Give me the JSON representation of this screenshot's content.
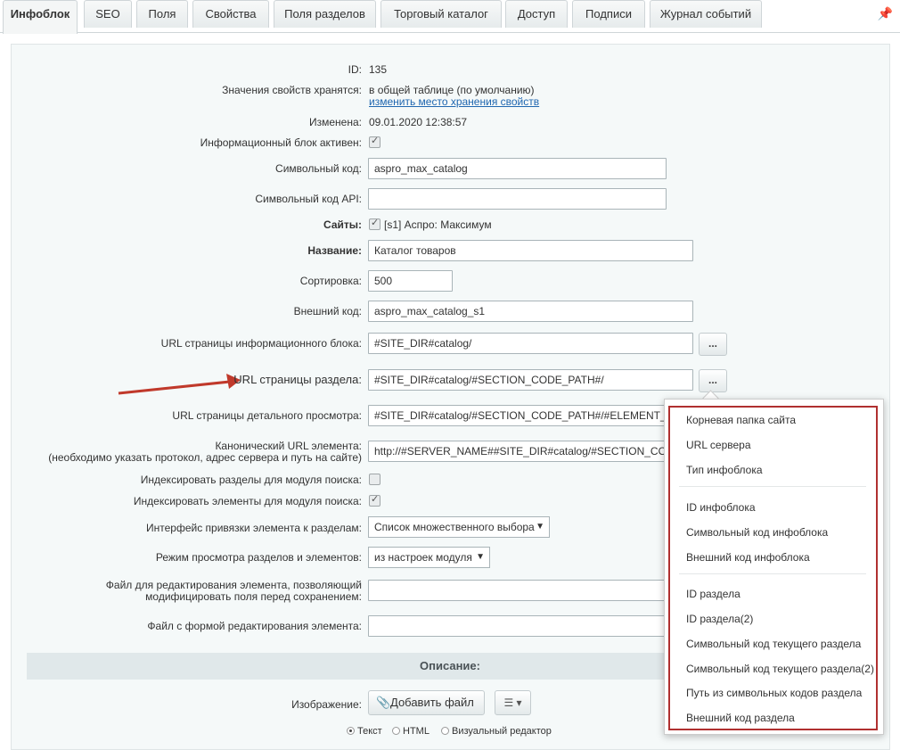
{
  "tabs": [
    "Инфоблок",
    "SEO",
    "Поля",
    "Свойства",
    "Поля разделов",
    "Торговый каталог",
    "Доступ",
    "Подписи",
    "Журнал событий"
  ],
  "form": {
    "id_label": "ID:",
    "id_value": "135",
    "storage_label": "Значения свойств хранятся:",
    "storage_value": "в общей таблице (по умолчанию)",
    "storage_link": "изменить место хранения свойств",
    "changed_label": "Изменена:",
    "changed_value": "09.01.2020 12:38:57",
    "active_label": "Информационный блок активен:",
    "code_label": "Символьный код:",
    "code_value": "aspro_max_catalog",
    "api_label": "Символьный код API:",
    "api_value": "",
    "sites_label": "Сайты:",
    "sites_value": "[s1] Аспро: Максимум",
    "name_label": "Название:",
    "name_value": "Каталог товаров",
    "sort_label": "Сортировка:",
    "sort_value": "500",
    "ext_label": "Внешний код:",
    "ext_value": "aspro_max_catalog_s1",
    "list_url_label": "URL страницы информационного блока:",
    "list_url_value": "#SITE_DIR#catalog/",
    "section_url_label": "URL страницы раздела:",
    "section_url_value": "#SITE_DIR#catalog/#SECTION_CODE_PATH#/",
    "detail_url_label": "URL страницы детального просмотра:",
    "detail_url_value": "#SITE_DIR#catalog/#SECTION_CODE_PATH#/#ELEMENT_CODE#/",
    "canonical_label_1": "Канонический URL элемента:",
    "canonical_label_2": "(необходимо указать протокол, адрес сервера и путь на сайте)",
    "canonical_value": "http://#SERVER_NAME##SITE_DIR#catalog/#SECTION_CODE_PATH#/",
    "idx_sections_label": "Индексировать разделы для модуля поиска:",
    "idx_elements_label": "Индексировать элементы для модуля поиска:",
    "binding_label": "Интерфейс привязки элемента к разделам:",
    "binding_value": "Список множественного выбора",
    "view_mode_label": "Режим просмотра разделов и элементов:",
    "view_mode_value": "из настроек модуля",
    "edit_file_label_1": "Файл для редактирования элемента, позволяющий",
    "edit_file_label_2": "модифицировать поля перед сохранением:",
    "form_file_label": "Файл с формой редактирования элемента:",
    "description_header": "Описание:",
    "image_label": "Изображение:",
    "add_file": "Добавить файл",
    "radio_text": "Текст",
    "radio_html": "HTML",
    "radio_visual": "Визуальный редактор"
  },
  "dots": "...",
  "popup": {
    "group1": [
      "Корневая папка сайта",
      "URL сервера",
      "Тип инфоблока"
    ],
    "group2": [
      "ID инфоблока",
      "Символьный код инфоблока",
      "Внешний код инфоблока"
    ],
    "group3": [
      "ID раздела",
      "ID раздела(2)",
      "Символьный код текущего раздела",
      "Символьный код текущего раздела(2)",
      "Путь из символьных кодов раздела",
      "Внешний код раздела"
    ]
  },
  "colors": {
    "arrow": "#c0392b",
    "popup_border": "#b03030",
    "link": "#2067b0"
  }
}
